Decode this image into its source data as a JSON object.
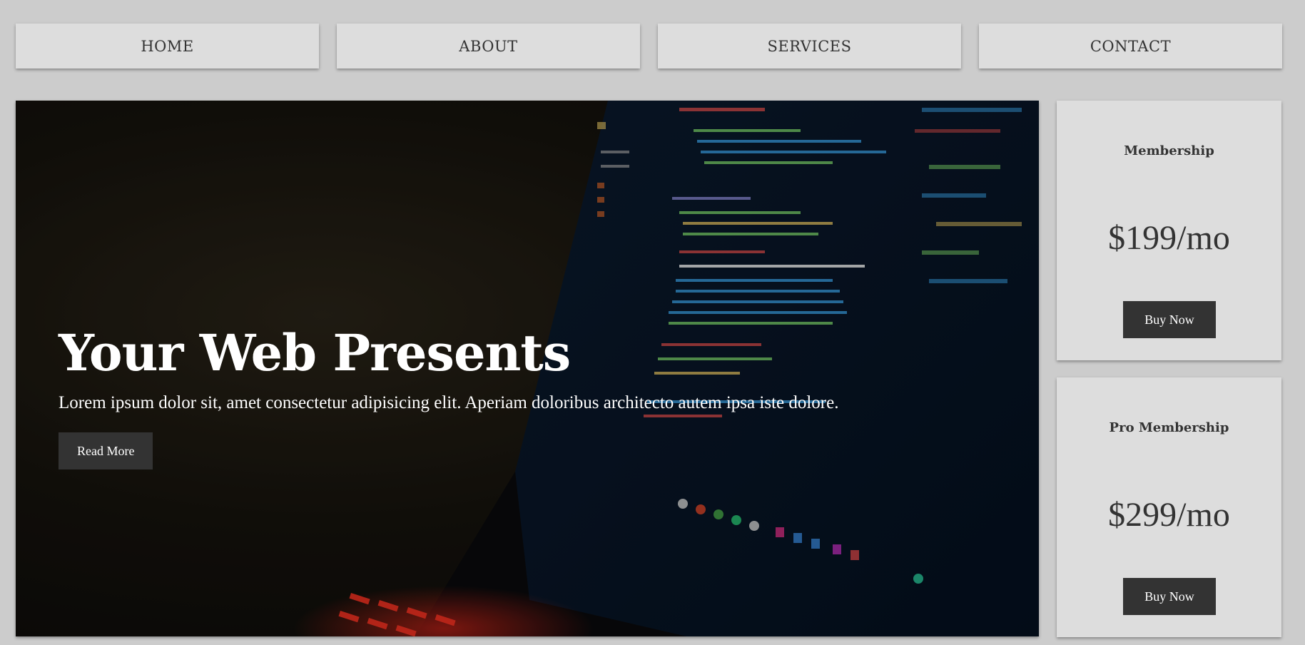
{
  "nav": {
    "items": [
      {
        "label": "HOME"
      },
      {
        "label": "ABOUT"
      },
      {
        "label": "SERVICES"
      },
      {
        "label": "CONTACT"
      }
    ]
  },
  "hero": {
    "title": "Your Web Presents",
    "text": "Lorem ipsum dolor sit, amet consectetur adipisicing elit. Aperiam doloribus architecto autem ipsa iste dolore.",
    "button_label": "Read More",
    "image_description_icon": "laptop-code-image"
  },
  "pricing": [
    {
      "title": "Membership",
      "price": "$199/mo",
      "button_label": "Buy Now"
    },
    {
      "title": "Pro Membership",
      "price": "$299/mo",
      "button_label": "Buy Now"
    }
  ],
  "colors": {
    "page_bg": "#cccccc",
    "card_bg": "#dddddd",
    "button_bg": "#333333",
    "text_dark": "#333333"
  }
}
